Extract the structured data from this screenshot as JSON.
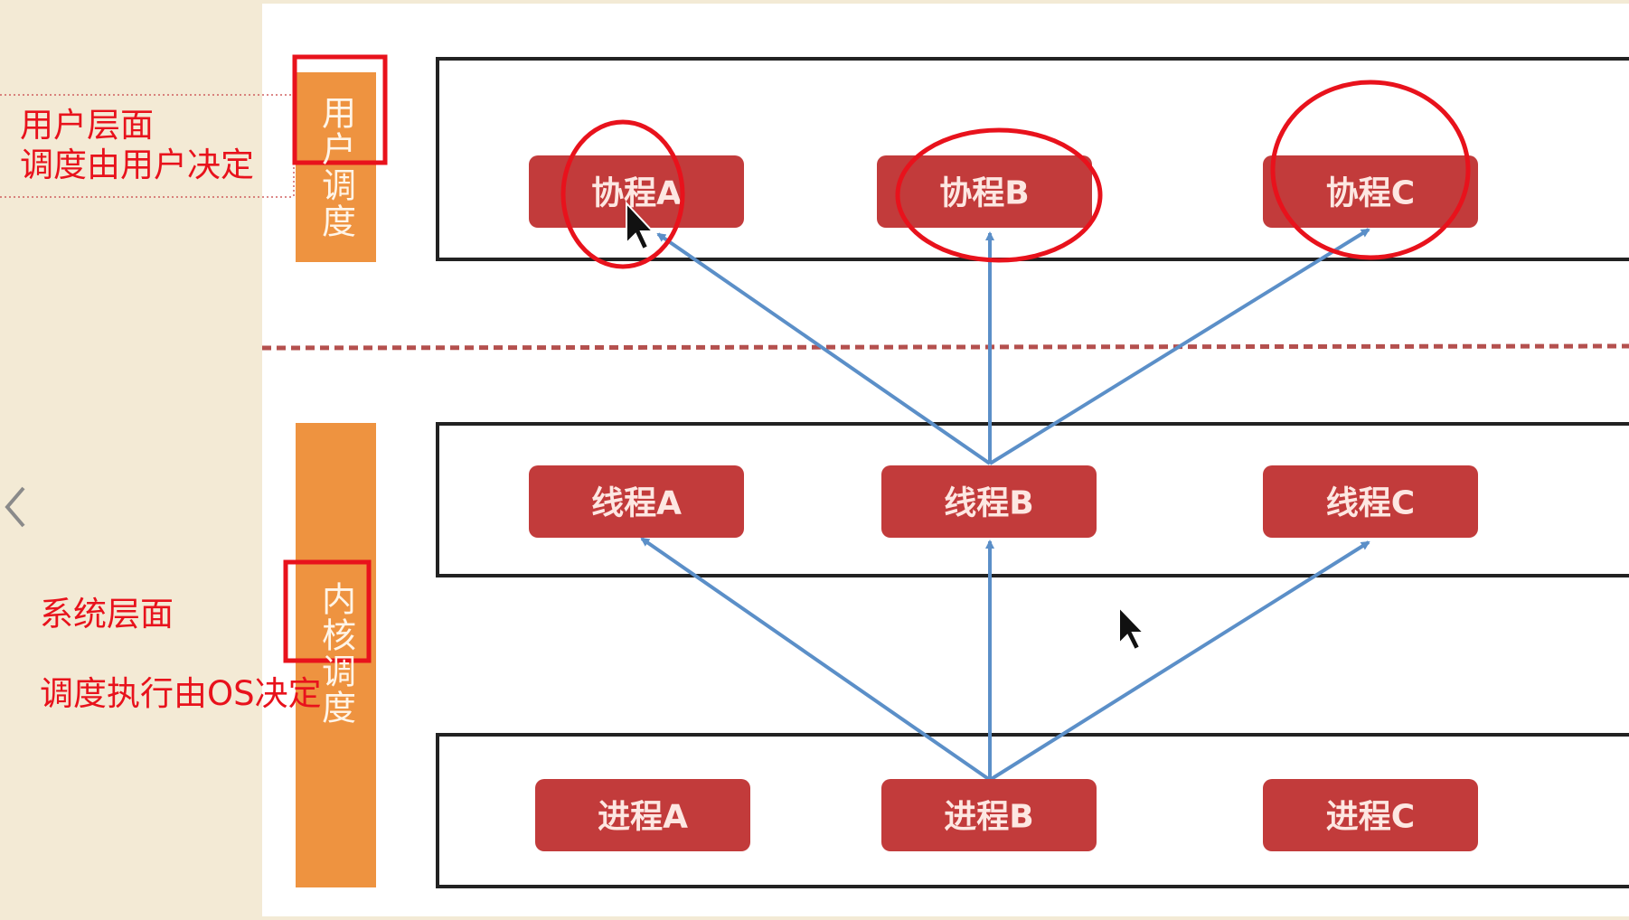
{
  "annotations": {
    "user_level": [
      "用户层面",
      "调度由用户决定"
    ],
    "system_level": "系统层面",
    "system_schedule": "调度执行由OS决定"
  },
  "side_bars": {
    "user": "用户调度",
    "kernel": "内核调度"
  },
  "nodes": {
    "coroutines": [
      "协程A",
      "协程B",
      "协程C"
    ],
    "threads": [
      "线程A",
      "线程B",
      "线程C"
    ],
    "processes": [
      "进程A",
      "进程B",
      "进程C"
    ]
  },
  "colors": {
    "background": "#f3ead5",
    "diagram_bg": "#ffffff",
    "node_fill": "#c23b3b",
    "side_bar": "#ee9340",
    "arrow": "#5b8fc8",
    "annotation": "#e8121c"
  },
  "icons": [
    "chevron-left-icon",
    "mouse-cursor-icon"
  ]
}
